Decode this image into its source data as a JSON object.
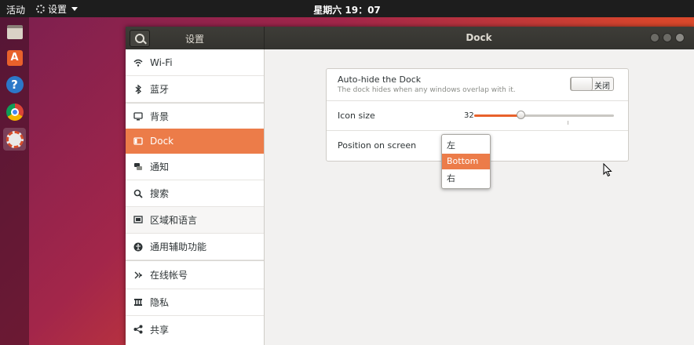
{
  "topbar": {
    "activities": "活动",
    "app_menu": "设置",
    "clock": "星期六 19：07"
  },
  "dock": {
    "items": [
      {
        "icon": "files-icon"
      },
      {
        "icon": "software-center-icon",
        "glyph": "A"
      },
      {
        "icon": "help-icon",
        "glyph": "?"
      },
      {
        "icon": "chromium-icon"
      },
      {
        "icon": "settings-icon"
      }
    ]
  },
  "window": {
    "sidebar_title": "设置",
    "title": "Dock"
  },
  "sidebar": {
    "items": [
      {
        "label": "Wi-Fi",
        "icon": "wifi-icon"
      },
      {
        "label": "蓝牙",
        "icon": "bluetooth-icon"
      },
      {
        "label": "背景",
        "icon": "background-icon"
      },
      {
        "label": "Dock",
        "icon": "dock-icon",
        "selected": true
      },
      {
        "label": "通知",
        "icon": "notifications-icon"
      },
      {
        "label": "搜索",
        "icon": "search-icon"
      },
      {
        "label": "区域和语言",
        "icon": "region-flag-icon"
      },
      {
        "label": "通用辅助功能",
        "icon": "accessibility-icon"
      },
      {
        "label": "在线帐号",
        "icon": "online-accounts-icon"
      },
      {
        "label": "隐私",
        "icon": "privacy-icon"
      },
      {
        "label": "共享",
        "icon": "share-icon"
      }
    ]
  },
  "dock_settings": {
    "autohide": {
      "label": "Auto-hide the Dock",
      "description": "The dock hides when any windows overlap with it.",
      "toggle_text": "关闭",
      "state": "off"
    },
    "icon_size": {
      "label": "Icon size",
      "value": "32",
      "fraction": 0.33
    },
    "position": {
      "label": "Position on screen",
      "options": [
        "左",
        "Bottom",
        "右"
      ],
      "selected": "Bottom"
    }
  },
  "colors": {
    "accent": "#e8612b",
    "selection": "#ec7c49",
    "header": "#3a3934"
  }
}
